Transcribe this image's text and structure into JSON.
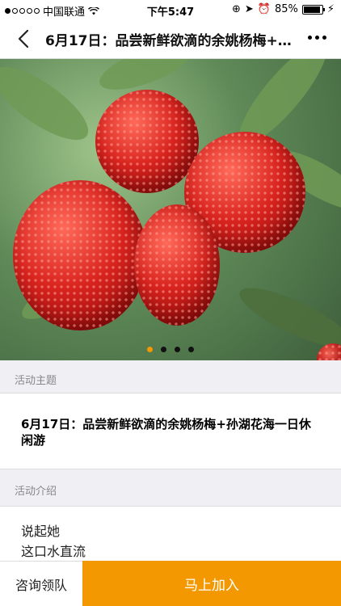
{
  "status_bar": {
    "carrier": "中国联通",
    "time": "下午5:47",
    "battery": "85%",
    "battery_level": 0.85
  },
  "nav": {
    "title": "6月17日：品尝新鲜欲滴的余姚杨梅+孙湖花海一日休闲游"
  },
  "banner": {
    "page_count": 4,
    "active_index": 0
  },
  "sections": {
    "theme_label": "活动主题",
    "theme_text": "6月17日：品尝新鲜欲滴的余姚杨梅+孙湖花海一日休闲游",
    "intro_label": "活动介绍",
    "intro_lines": [
      "说起她",
      "这口水直流"
    ]
  },
  "bottom_bar": {
    "consult_label": "咨询领队",
    "join_label": "马上加入"
  },
  "colors": {
    "accent": "#f39800"
  }
}
